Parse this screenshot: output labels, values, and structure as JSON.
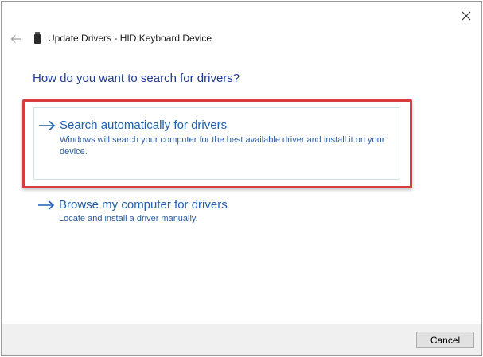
{
  "window": {
    "title": "Update Drivers - HID Keyboard Device"
  },
  "icons": {
    "close": "close-icon",
    "back": "back-arrow-icon",
    "device": "keyboard-device-icon",
    "option_arrow": "right-arrow-icon"
  },
  "page": {
    "heading": "How do you want to search for drivers?"
  },
  "options": [
    {
      "title": "Search automatically for drivers",
      "description": "Windows will search your computer for the best available driver and install it on your device.",
      "highlighted": true
    },
    {
      "title": "Browse my computer for drivers",
      "description": "Locate and install a driver manually.",
      "highlighted": false
    }
  ],
  "footer": {
    "cancel_label": "Cancel"
  },
  "colors": {
    "heading": "#1f3b99",
    "link": "#2060b0",
    "highlight": "#d83c3c",
    "footer_bg": "#f0f0f0"
  }
}
